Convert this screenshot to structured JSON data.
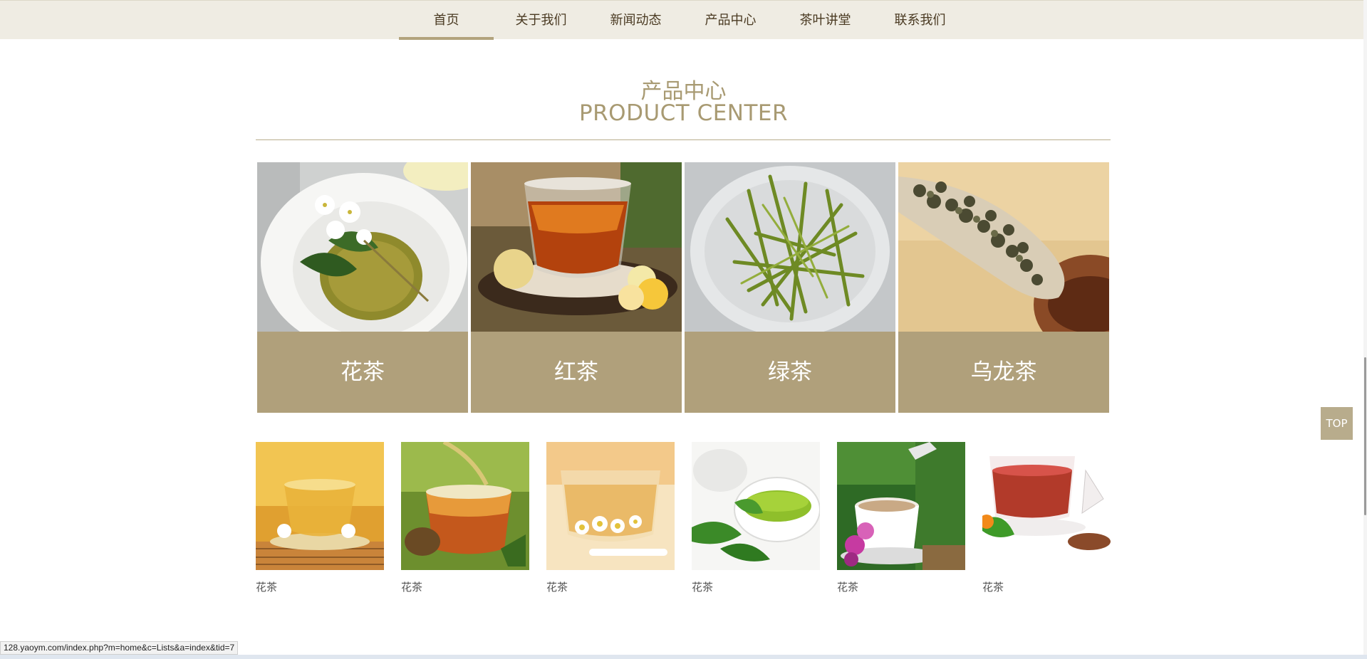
{
  "nav": {
    "items": [
      {
        "label": "首页"
      },
      {
        "label": "关于我们"
      },
      {
        "label": "新闻动态"
      },
      {
        "label": "产品中心"
      },
      {
        "label": "茶叶讲堂"
      },
      {
        "label": "联系我们"
      }
    ],
    "active_index": 0
  },
  "section": {
    "title_cn": "产品中心",
    "title_en": "PRODUCT CENTER"
  },
  "categories": [
    {
      "label": "花茶",
      "image": "jasmine-tea-teapot"
    },
    {
      "label": "红茶",
      "image": "black-tea-glass-cup"
    },
    {
      "label": "绿茶",
      "image": "green-tea-leaves"
    },
    {
      "label": "乌龙茶",
      "image": "oolong-tea-scoop"
    }
  ],
  "products": [
    {
      "name": "花茶",
      "image": "golden-tea-cup"
    },
    {
      "name": "花茶",
      "image": "pouring-tea"
    },
    {
      "name": "花茶",
      "image": "chrysanthemum-tea"
    },
    {
      "name": "花茶",
      "image": "green-tea-cup"
    },
    {
      "name": "花茶",
      "image": "milk-tea-orchid"
    },
    {
      "name": "花茶",
      "image": "red-tea-cup"
    }
  ],
  "top_button": {
    "label": "TOP"
  },
  "status_bar": {
    "url": "128.yaoym.com/index.php?m=home&c=Lists&a=index&tid=7"
  },
  "colors": {
    "accent": "#b0a07b",
    "nav_bg": "#efece3",
    "title": "#a89a72"
  }
}
